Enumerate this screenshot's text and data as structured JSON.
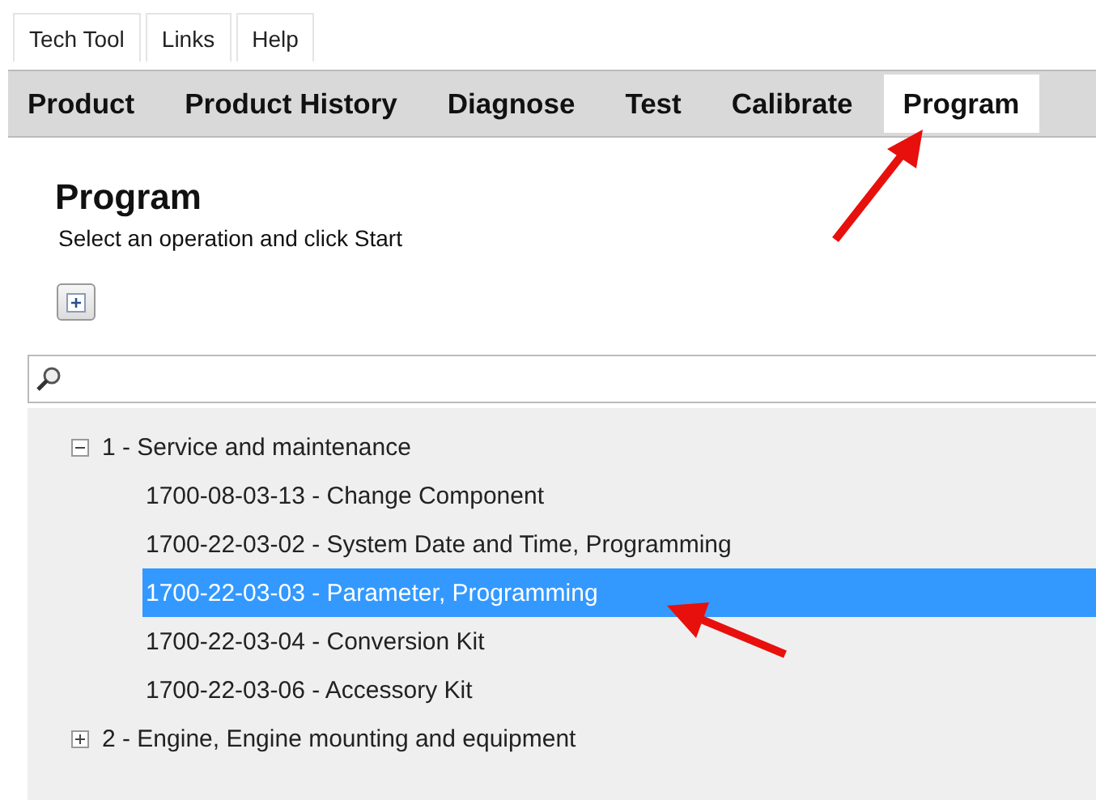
{
  "menu": [
    {
      "label": "Tech Tool"
    },
    {
      "label": "Links"
    },
    {
      "label": "Help"
    }
  ],
  "tabs": [
    {
      "label": "Product",
      "selected": false
    },
    {
      "label": "Product History",
      "selected": false
    },
    {
      "label": "Diagnose",
      "selected": false
    },
    {
      "label": "Test",
      "selected": false
    },
    {
      "label": "Calibrate",
      "selected": false
    },
    {
      "label": "Program",
      "selected": true
    }
  ],
  "heading": "Program",
  "instruction": "Select an operation and click Start",
  "tree": [
    {
      "label": "1 - Service and maintenance",
      "expanded": true,
      "children": [
        {
          "label": "1700-08-03-13 - Change Component",
          "selected": false
        },
        {
          "label": "1700-22-03-02 - System Date and Time, Programming",
          "selected": false
        },
        {
          "label": "1700-22-03-03 - Parameter, Programming",
          "selected": true
        },
        {
          "label": "1700-22-03-04 - Conversion Kit",
          "selected": false
        },
        {
          "label": "1700-22-03-06 - Accessory Kit",
          "selected": false
        }
      ]
    },
    {
      "label": "2 - Engine, Engine mounting and equipment",
      "expanded": false
    }
  ]
}
